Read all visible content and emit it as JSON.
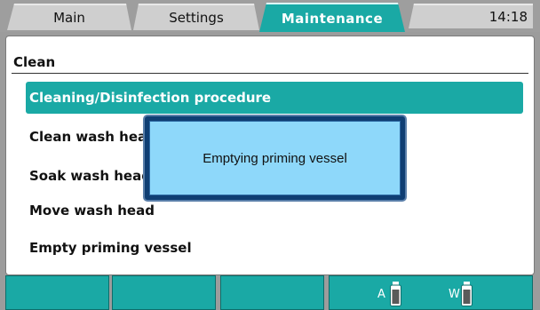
{
  "tabs": {
    "main": "Main",
    "settings": "Settings",
    "maintenance": "Maintenance",
    "clock": "14:18"
  },
  "section": {
    "title": "Clean"
  },
  "menu": {
    "items": [
      {
        "label": "Cleaning/Disinfection procedure",
        "selected": true
      },
      {
        "label": "Clean wash head"
      },
      {
        "label": "Soak wash head"
      },
      {
        "label": "Move wash head"
      },
      {
        "label": "Empty priming vessel"
      }
    ]
  },
  "dialog": {
    "message": "Emptying priming vessel"
  },
  "status": {
    "bottle_a_label": "A",
    "bottle_w_label": "W"
  },
  "colors": {
    "accent": "#1aa9a5",
    "dialog_bg": "#8ed8fa",
    "dialog_frame": "#0f3e73"
  }
}
